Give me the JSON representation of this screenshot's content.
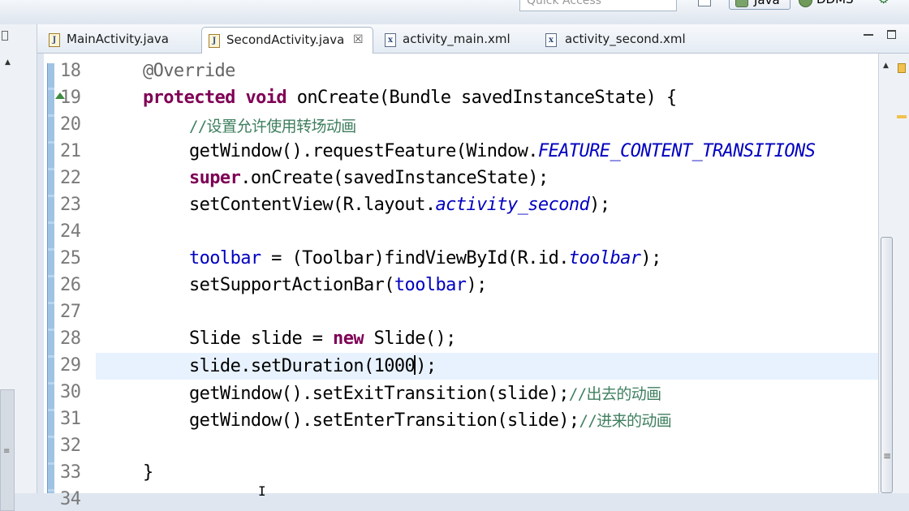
{
  "toolbar": {
    "quick_access_placeholder": "Quick Access",
    "perspectives": [
      {
        "label": "Java",
        "icon": "java-perspective-icon"
      },
      {
        "label": "DDMS",
        "icon": "ddms-perspective-icon"
      }
    ]
  },
  "tabs": [
    {
      "label": "MainActivity.java",
      "icon": "java-file-icon",
      "active": false
    },
    {
      "label": "SecondActivity.java",
      "icon": "java-file-icon",
      "active": true,
      "close": "☒"
    },
    {
      "label": "activity_main.xml",
      "icon": "xml-file-icon",
      "active": false
    },
    {
      "label": "activity_second.xml",
      "icon": "xml-file-icon",
      "active": false
    }
  ],
  "editor": {
    "current_line": "29",
    "lines": [
      {
        "no": "18"
      },
      {
        "no": "19"
      },
      {
        "no": "20"
      },
      {
        "no": "21"
      },
      {
        "no": "22"
      },
      {
        "no": "23"
      },
      {
        "no": "24"
      },
      {
        "no": "25"
      },
      {
        "no": "26"
      },
      {
        "no": "27"
      },
      {
        "no": "28"
      },
      {
        "no": "29"
      },
      {
        "no": "30"
      },
      {
        "no": "31"
      },
      {
        "no": "32"
      },
      {
        "no": "33"
      },
      {
        "no": "34"
      }
    ],
    "code": {
      "l18": {
        "annotation": "@Override"
      },
      "l19": {
        "kw1": "protected",
        "kw2": "void",
        "rest": " onCreate(Bundle savedInstanceState) {"
      },
      "l20": {
        "comment": "//设置允许使用转场动画"
      },
      "l21": {
        "pre": "getWindow().requestFeature(Window.",
        "const": "FEATURE_CONTENT_TRANSITIONS"
      },
      "l22": {
        "kw": "super",
        "rest": ".onCreate(savedInstanceState);"
      },
      "l23": {
        "pre": "setContentView(R.layout.",
        "field": "activity_second",
        "post": ");"
      },
      "l25": {
        "field1": "toolbar",
        "mid": " = (Toolbar)findViewById(R.id.",
        "field2": "toolbar",
        "post": ");"
      },
      "l26": {
        "pre": "setSupportActionBar(",
        "field": "toolbar",
        "post": ");"
      },
      "l28": {
        "pre": "Slide slide = ",
        "kw": "new",
        "post": " Slide();"
      },
      "l29": {
        "pre": "slide.setDuration(1000",
        "post": ");"
      },
      "l30": {
        "pre": "getWindow().setExitTransition(slide);",
        "comment": "//出去的动画"
      },
      "l31": {
        "pre": "getWindow().setEnterTransition(slide);",
        "comment": "//进来的动画"
      },
      "l33": {
        "brace": "}"
      }
    }
  }
}
